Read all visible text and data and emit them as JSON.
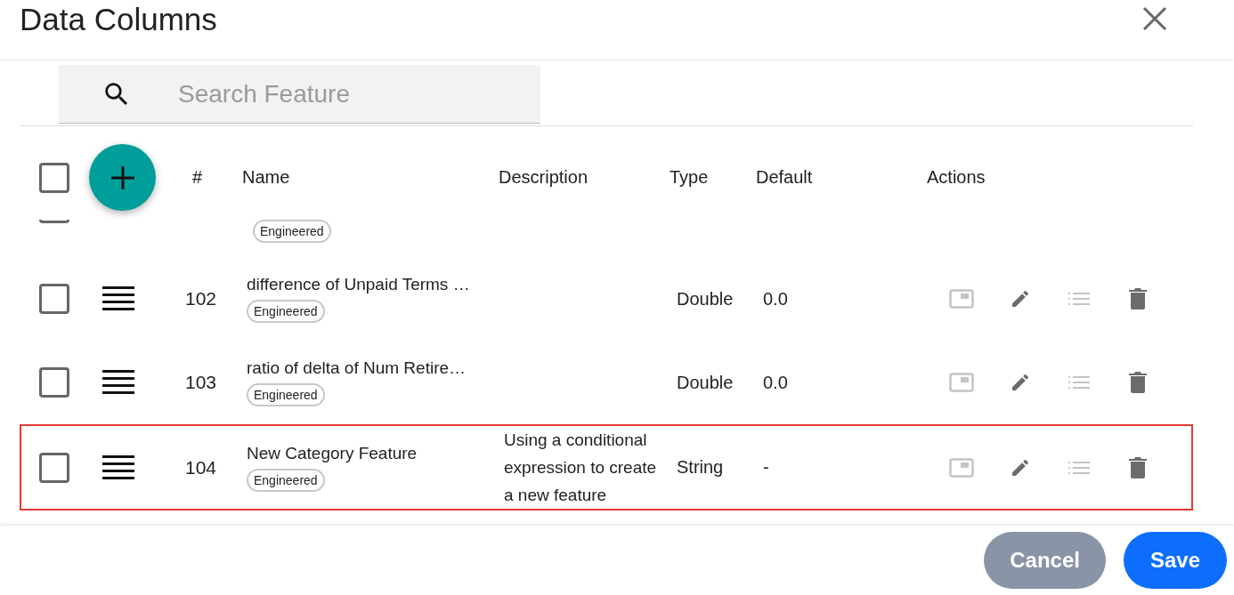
{
  "dialog": {
    "title": "Data Columns"
  },
  "search": {
    "placeholder": "Search Feature"
  },
  "table": {
    "select_all": {
      "checked": false
    },
    "columns": [
      "#",
      "Name",
      "Description",
      "Type",
      "Default",
      "Actions"
    ],
    "partial_row": {
      "checked": false,
      "tag": "Engineered"
    },
    "rows": [
      {
        "number": "102",
        "name": "difference of Unpaid Terms …",
        "tag": "Engineered",
        "description": "",
        "type": "Double",
        "default": "0.0",
        "checked": false,
        "highlighted": false,
        "actions": [
          {
            "kind": "preview",
            "disabled": true
          },
          {
            "kind": "edit",
            "disabled": false
          },
          {
            "kind": "details",
            "disabled": true
          },
          {
            "kind": "delete",
            "disabled": false
          }
        ]
      },
      {
        "number": "103",
        "name": "ratio of delta of Num Retire…",
        "tag": "Engineered",
        "description": "",
        "type": "Double",
        "default": "0.0",
        "checked": false,
        "highlighted": false,
        "actions": [
          {
            "kind": "preview",
            "disabled": true
          },
          {
            "kind": "edit",
            "disabled": false
          },
          {
            "kind": "details",
            "disabled": true
          },
          {
            "kind": "delete",
            "disabled": false
          }
        ]
      },
      {
        "number": "104",
        "name": "New Category Feature",
        "tag": "Engineered",
        "description": "Using a conditional expression to create a new feature",
        "type": "String",
        "default": "-",
        "checked": false,
        "highlighted": true,
        "actions": [
          {
            "kind": "preview",
            "disabled": true
          },
          {
            "kind": "edit",
            "disabled": false
          },
          {
            "kind": "details",
            "disabled": true
          },
          {
            "kind": "delete",
            "disabled": false
          }
        ]
      }
    ]
  },
  "buttons": [
    {
      "label": "Cancel",
      "kind": "secondary"
    },
    {
      "label": "Save",
      "kind": "primary"
    }
  ]
}
